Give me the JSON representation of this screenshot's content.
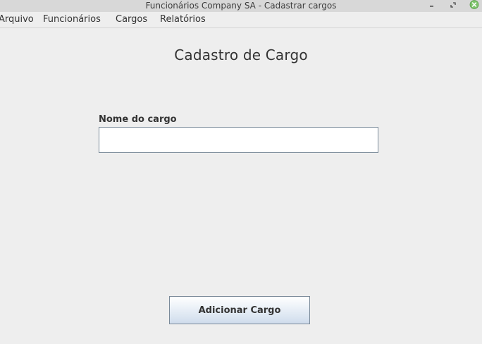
{
  "window": {
    "title": "Funcionários Company SA - Cadastrar cargos"
  },
  "menubar": {
    "items": [
      {
        "label": "Arquivo"
      },
      {
        "label": "Funcionários"
      },
      {
        "label": "Cargos"
      },
      {
        "label": "Relatórios"
      }
    ]
  },
  "form": {
    "heading": "Cadastro de Cargo",
    "name_label": "Nome do cargo",
    "name_value": "",
    "submit_label": "Adicionar Cargo"
  },
  "icons": {
    "minimize": "minimize-icon",
    "maximize": "maximize-icon",
    "close": "close-icon"
  },
  "colors": {
    "background": "#eeeeee",
    "titlebar": "#d8d8d8",
    "close_button": "#7cc36a",
    "input_border": "#7a8a99",
    "button_gradient_bottom": "#cfdcec"
  }
}
